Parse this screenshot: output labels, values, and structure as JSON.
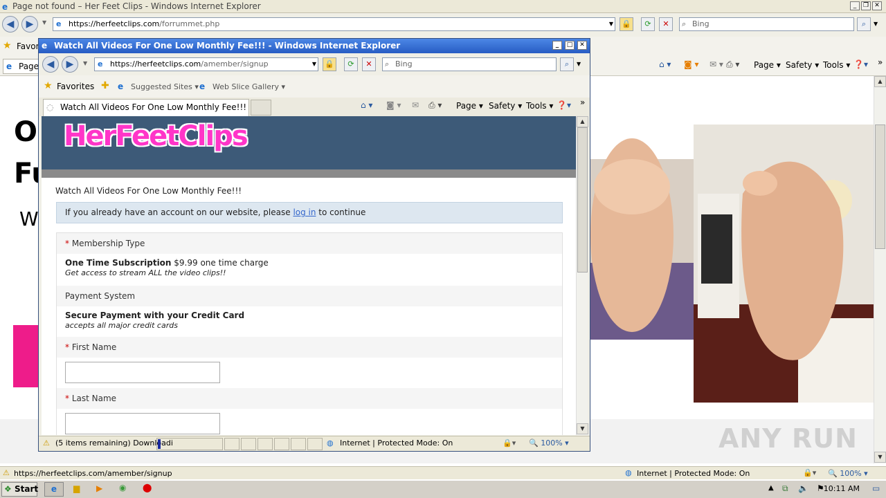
{
  "back_window": {
    "title": "Page not found – Her Feet Clips - Windows Internet Explorer",
    "url_domain": "https://herfeetclips.com",
    "url_path": "/forrummet.php",
    "search_placeholder": "Bing",
    "favorites_partial": "Favori",
    "tab_partial": "Page",
    "cmd": {
      "page": "Page",
      "safety": "Safety",
      "tools": "Tools"
    },
    "content_letters": [
      "O",
      "Fu",
      "W"
    ],
    "status_url": "https://herfeetclips.com/amember/signup",
    "status_zone": "Internet | Protected Mode: On",
    "zoom": "100%"
  },
  "front_window": {
    "title": "Watch All Videos For One Low Monthly Fee!!! - Windows Internet Explorer",
    "url_domain": "https://herfeetclips.com",
    "url_path": "/amember/signup",
    "search_placeholder": "Bing",
    "favorites": "Favorites",
    "suggested_sites": "Suggested Sites",
    "web_slice": "Web Slice Gallery",
    "tab_title": "Watch All Videos For One Low Monthly Fee!!!",
    "cmd": {
      "page": "Page",
      "safety": "Safety",
      "tools": "Tools"
    },
    "status_downloading": "(5 items remaining) Downloadi",
    "status_zone": "Internet | Protected Mode: On",
    "zoom": "100%"
  },
  "page": {
    "logo": "HerFeetClips",
    "heading": "Watch All Videos For One Low Monthly Fee!!!",
    "login_prefix": "If you already have an account on our website, please ",
    "login_link": "log in",
    "login_suffix": " to continue",
    "membership_label": "Membership Type",
    "membership_name": "One Time Subscription",
    "membership_price": " $9.99 one time charge",
    "membership_desc": "Get access to stream ALL the video clips!!",
    "payment_label": "Payment System",
    "payment_name": "Secure Payment with your Credit Card",
    "payment_desc": "accepts all major credit cards",
    "first_name_label": "First Name",
    "last_name_label": "Last Name",
    "required_mark": "*"
  },
  "taskbar": {
    "start": "Start",
    "clock": "10:11 AM"
  },
  "watermark": "ANY RUN"
}
